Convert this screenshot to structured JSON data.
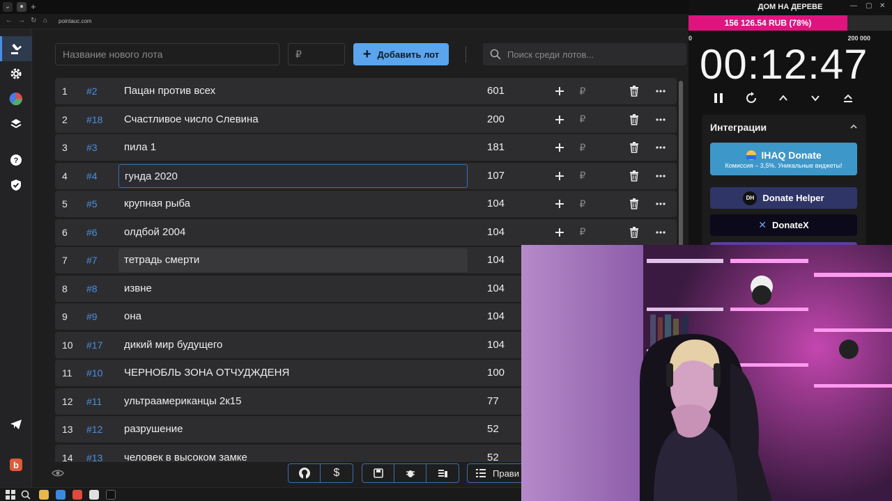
{
  "browser": {
    "url": "pointauc.com"
  },
  "form": {
    "lot_name_placeholder": "Название нового лота",
    "amount_placeholder": "₽",
    "add_button_label": "Добавить лот",
    "search_placeholder": "Поиск среди лотов..."
  },
  "lots": [
    {
      "idx": "1",
      "id": "#2",
      "name": "Пацан против всех",
      "amount": "601"
    },
    {
      "idx": "2",
      "id": "#18",
      "name": "Счастливое число Слевина",
      "amount": "200"
    },
    {
      "idx": "3",
      "id": "#3",
      "name": "пила 1",
      "amount": "181"
    },
    {
      "idx": "4",
      "id": "#4",
      "name": "гунда 2020",
      "amount": "107"
    },
    {
      "idx": "5",
      "id": "#5",
      "name": "крупная рыба",
      "amount": "104"
    },
    {
      "idx": "6",
      "id": "#6",
      "name": "олдбой 2004",
      "amount": "104"
    },
    {
      "idx": "7",
      "id": "#7",
      "name": "тетрадь смерти",
      "amount": "104"
    },
    {
      "idx": "8",
      "id": "#8",
      "name": "извне",
      "amount": "104"
    },
    {
      "idx": "9",
      "id": "#9",
      "name": "она",
      "amount": "104"
    },
    {
      "idx": "10",
      "id": "#17",
      "name": "дикий мир будущего",
      "amount": "104"
    },
    {
      "idx": "11",
      "id": "#10",
      "name": "ЧЕРНОБЛЬ ЗОНА ОТЧУДЖДЕНЯ",
      "amount": "100"
    },
    {
      "idx": "12",
      "id": "#11",
      "name": "ультраамериканцы 2к15",
      "amount": "77"
    },
    {
      "idx": "13",
      "id": "#12",
      "name": "разрушение",
      "amount": "52"
    },
    {
      "idx": "14",
      "id": "#13",
      "name": "человек в высоком замке",
      "amount": "52"
    }
  ],
  "row_action_rub": "₽",
  "bottom_toolbar": {
    "rules_label": "Прави"
  },
  "stream": {
    "title": "ДОМ НА ДЕРЕВЕ",
    "progress_text": "156 126.54 RUB (78%)",
    "progress_fraction": 0.78,
    "progress_color": "#e0147f",
    "scale_min": "0",
    "scale_max": "200 000",
    "timer": "00:12:47"
  },
  "integrations": {
    "title": "Интеграции",
    "ihaq_label": "IHAQ Donate",
    "ihaq_sub": "Комиссия – 3,5%. Уникальные виджеты!",
    "donate_helper_label": "Donate Helper",
    "donate_helper_logo": "DH",
    "donatex_label": "DonateX"
  },
  "colors": {
    "accent": "#5aa5ee",
    "lot_id": "#4a90e2",
    "ihaq": "#3e97c9"
  }
}
